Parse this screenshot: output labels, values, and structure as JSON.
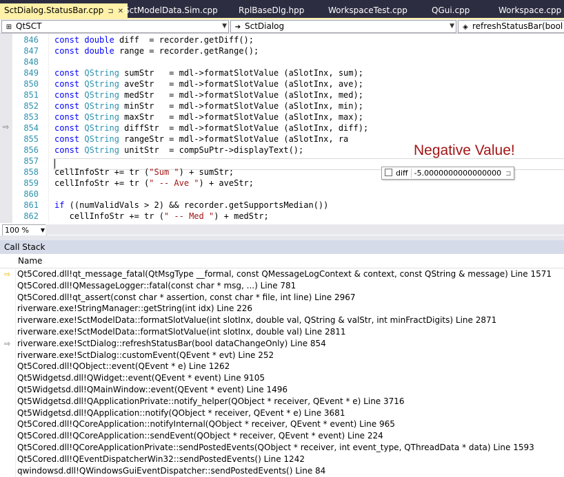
{
  "tabs": [
    {
      "label": "SctDialog.StatusBar.cpp",
      "active": true
    },
    {
      "label": "SctModelData.Sim.cpp",
      "active": false
    },
    {
      "label": "RplBaseDlg.hpp",
      "active": false
    },
    {
      "label": "WorkspaceTest.cpp",
      "active": false
    },
    {
      "label": "QGui.cpp",
      "active": false
    },
    {
      "label": "Workspace.cpp",
      "active": false
    }
  ],
  "navbar": {
    "project": "QtSCT",
    "scope": "SctDialog",
    "member": "refreshStatusBar(bool dataChangeOnly)"
  },
  "editor": {
    "zoom": "100 %",
    "lines": [
      {
        "n": "846",
        "html": "<span class=\"kw\">const</span> <span class=\"kw\">double</span> diff  = recorder.getDiff();"
      },
      {
        "n": "847",
        "html": "<span class=\"kw\">const</span> <span class=\"kw\">double</span> range = recorder.getRange();"
      },
      {
        "n": "848",
        "html": ""
      },
      {
        "n": "849",
        "html": "<span class=\"kw\">const</span> <span class=\"ty\">QString</span> sumStr   = mdl-&gt;formatSlotValue (aSlotInx, sum);"
      },
      {
        "n": "850",
        "html": "<span class=\"kw\">const</span> <span class=\"ty\">QString</span> aveStr   = mdl-&gt;formatSlotValue (aSlotInx, ave);"
      },
      {
        "n": "851",
        "html": "<span class=\"kw\">const</span> <span class=\"ty\">QString</span> medStr   = mdl-&gt;formatSlotValue (aSlotInx, med);"
      },
      {
        "n": "852",
        "html": "<span class=\"kw\">const</span> <span class=\"ty\">QString</span> minStr   = mdl-&gt;formatSlotValue (aSlotInx, min);"
      },
      {
        "n": "853",
        "html": "<span class=\"kw\">const</span> <span class=\"ty\">QString</span> maxStr   = mdl-&gt;formatSlotValue (aSlotInx, max);"
      },
      {
        "n": "854",
        "html": "<span class=\"kw\">const</span> <span class=\"ty\">QString</span> diffStr  = mdl-&gt;formatSlotValue (aSlotInx, diff);"
      },
      {
        "n": "855",
        "html": "<span class=\"kw\">const</span> <span class=\"ty\">QString</span> rangeStr = mdl-&gt;formatSlotValue (aSlotInx, ra"
      },
      {
        "n": "856",
        "html": "<span class=\"kw\">const</span> <span class=\"ty\">QString</span> unitStr  = compSuPtr-&gt;displayText();"
      },
      {
        "n": "857",
        "html": ""
      },
      {
        "n": "858",
        "html": "cellInfoStr += tr (<span class=\"str\">\"Sum \"</span>) + sumStr;"
      },
      {
        "n": "859",
        "html": "cellInfoStr += tr (<span class=\"str\">\" -- Ave \"</span>) + aveStr;"
      },
      {
        "n": "860",
        "html": ""
      },
      {
        "n": "861",
        "html": "<span class=\"kw\">if</span> ((numValidVals &gt; 2) &amp;&amp; recorder.getSupportsMedian())"
      },
      {
        "n": "862",
        "html": "   cellInfoStr += tr (<span class=\"str\">\" -- Med \"</span>) + medStr;"
      }
    ],
    "annotation": "Negative Value!",
    "datatip": {
      "name": "diff",
      "value": "-5.0000000000000000"
    }
  },
  "callstack": {
    "title": "Call Stack",
    "column": "Name",
    "frames": [
      {
        "marker": "current",
        "text": "Qt5Cored.dll!qt_message_fatal(QtMsgType __formal, const QMessageLogContext & context, const QString & message) Line 1571"
      },
      {
        "marker": "",
        "text": "Qt5Cored.dll!QMessageLogger::fatal(const char * msg, ...) Line 781"
      },
      {
        "marker": "",
        "text": "Qt5Cored.dll!qt_assert(const char * assertion, const char * file, int line) Line 2967"
      },
      {
        "marker": "",
        "text": "riverware.exe!StringManager::getString(int idx) Line 226"
      },
      {
        "marker": "",
        "text": "riverware.exe!SctModelData::formatSlotValue(int slotInx, double val, QString & valStr, int minFractDigits) Line 2871"
      },
      {
        "marker": "",
        "text": "riverware.exe!SctModelData::formatSlotValue(int slotInx, double val) Line 2811"
      },
      {
        "marker": "caller",
        "text": "riverware.exe!SctDialog::refreshStatusBar(bool dataChangeOnly) Line 854"
      },
      {
        "marker": "",
        "text": "riverware.exe!SctDialog::customEvent(QEvent * evt) Line 252"
      },
      {
        "marker": "",
        "text": "Qt5Cored.dll!QObject::event(QEvent * e) Line 1262"
      },
      {
        "marker": "",
        "text": "Qt5Widgetsd.dll!QWidget::event(QEvent * event) Line 9105"
      },
      {
        "marker": "",
        "text": "Qt5Widgetsd.dll!QMainWindow::event(QEvent * event) Line 1496"
      },
      {
        "marker": "",
        "text": "Qt5Widgetsd.dll!QApplicationPrivate::notify_helper(QObject * receiver, QEvent * e) Line 3716"
      },
      {
        "marker": "",
        "text": "Qt5Widgetsd.dll!QApplication::notify(QObject * receiver, QEvent * e) Line 3681"
      },
      {
        "marker": "",
        "text": "Qt5Cored.dll!QCoreApplication::notifyInternal(QObject * receiver, QEvent * event) Line 965"
      },
      {
        "marker": "",
        "text": "Qt5Cored.dll!QCoreApplication::sendEvent(QObject * receiver, QEvent * event) Line 224"
      },
      {
        "marker": "",
        "text": "Qt5Cored.dll!QCoreApplicationPrivate::sendPostedEvents(QObject * receiver, int event_type, QThreadData * data) Line 1593"
      },
      {
        "marker": "",
        "text": "Qt5Cored.dll!QEventDispatcherWin32::sendPostedEvents() Line 1242"
      },
      {
        "marker": "",
        "text": "qwindowsd.dll!QWindowsGuiEventDispatcher::sendPostedEvents() Line 84"
      }
    ]
  }
}
